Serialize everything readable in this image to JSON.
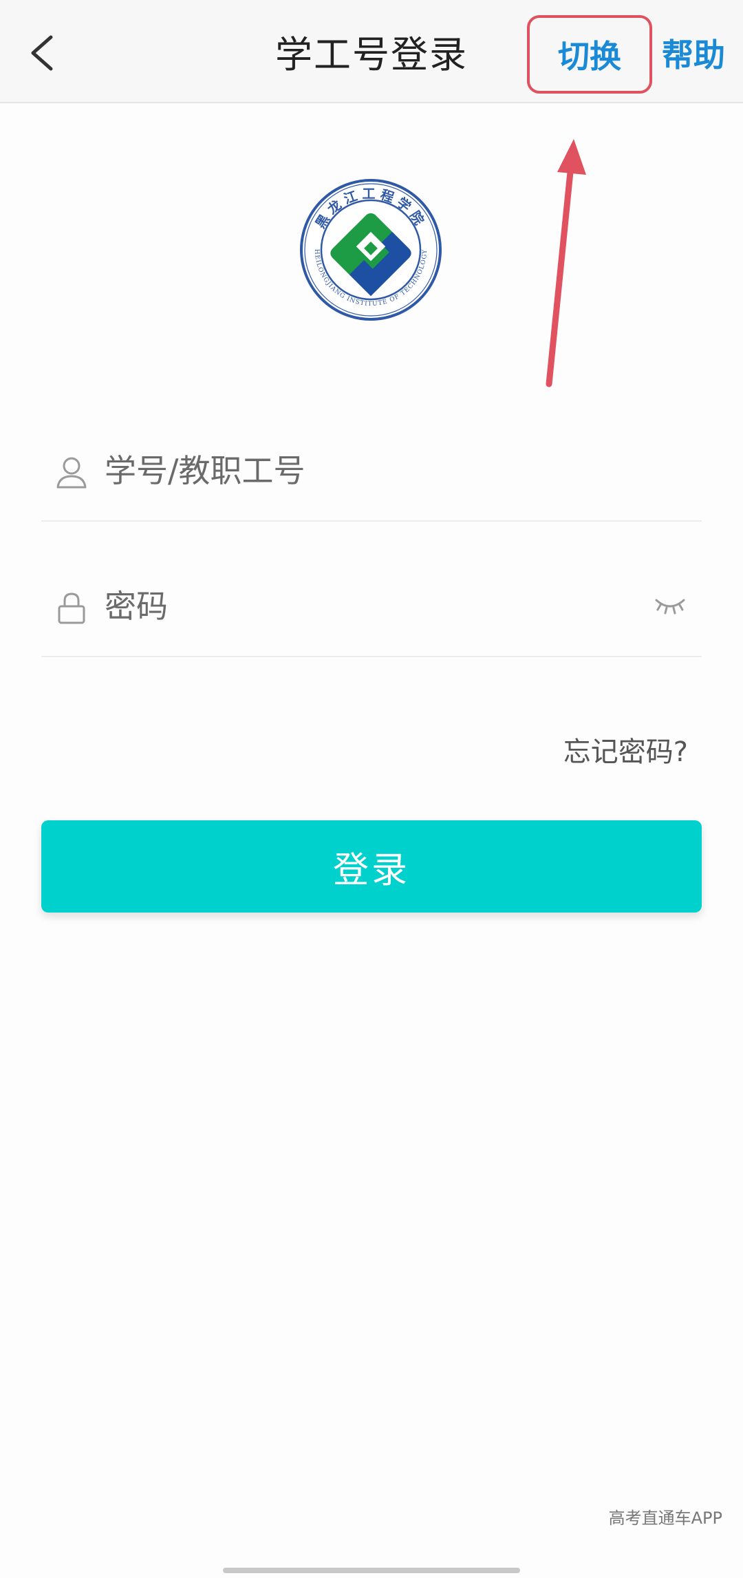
{
  "header": {
    "title": "学工号登录",
    "switch_label": "切换",
    "help_label": "帮助"
  },
  "logo": {
    "text_top": "黑龙江工程学院",
    "text_bottom": "HEILONGJIANG INSTITUTE OF TECHNOLOGY"
  },
  "form": {
    "username": {
      "value": "",
      "placeholder": "学号/教职工号",
      "icon": "user-icon"
    },
    "password": {
      "value": "",
      "placeholder": "密码",
      "icon": "lock-icon",
      "toggle_icon": "eye-closed-icon"
    },
    "forgot_label": "忘记密码?",
    "submit_label": "登录"
  },
  "watermark": "高考直通车APP",
  "colors": {
    "accent": "#1a8ad6",
    "primary_button": "#00d1cd",
    "annotation": "#e0525f"
  }
}
